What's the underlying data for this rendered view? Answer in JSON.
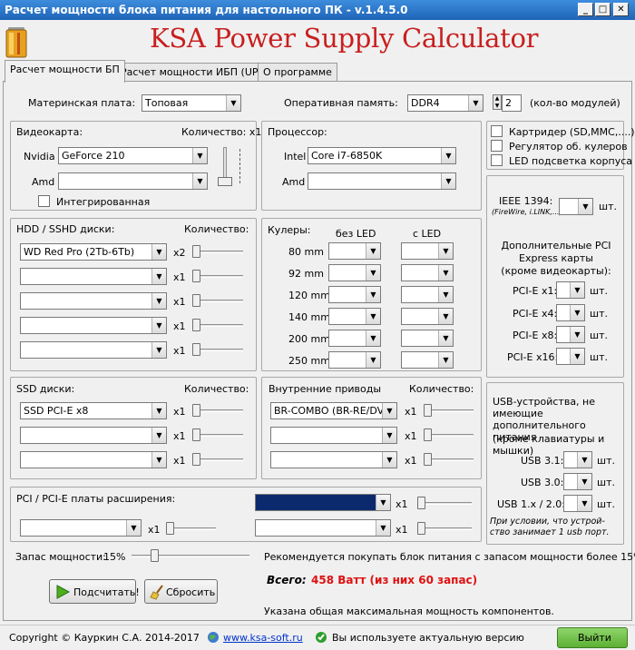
{
  "window": {
    "title": "Расчет мощности блока питания для настольного ПК - v.1.4.5.0",
    "min": "_",
    "max": "□",
    "close": "✕"
  },
  "app": {
    "title": "KSA Power Supply Calculator"
  },
  "tabs": [
    "Расчет мощности БП",
    "Расчет мощности ИБП (UPS)",
    "О программе"
  ],
  "top": {
    "mb_label": "Материнская плата:",
    "mb_value": "Топовая",
    "ram_label": "Оперативная память:",
    "ram_value": "DDR4",
    "ram_modules": "2",
    "ram_modules_note": "(кол-во модулей)"
  },
  "gpu": {
    "title": "Видеокарта:",
    "qty_label": "Количество: x1",
    "nvidia_label": "Nvidia",
    "nvidia_value": "GeForce 210",
    "amd_label": "Amd",
    "amd_value": "",
    "integrated": "Интегрированная"
  },
  "cpu": {
    "title": "Процессор:",
    "intel_label": "Intel",
    "intel_value": "Core i7-6850K",
    "amd_label": "Amd",
    "amd_value": ""
  },
  "extras": {
    "cardreader": "Картридер (SD,MMC,....)",
    "fan_ctrl": "Регулятор об. кулеров",
    "led": "LED подсветка корпуса"
  },
  "ieee": {
    "label": "IEEE 1394:",
    "sub": "(FireWire, i.LINK,...)",
    "unit": "шт."
  },
  "pcie": {
    "title": "Дополнительные PCI Express карты (кроме видеокарты):",
    "rows": [
      {
        "label": "PCI-E x1:",
        "unit": "шт."
      },
      {
        "label": "PCI-E x4:",
        "unit": "шт."
      },
      {
        "label": "PCI-E x8:",
        "unit": "шт."
      },
      {
        "label": "PCI-E x16:",
        "unit": "шт."
      }
    ]
  },
  "usb": {
    "title": "USB-устройства, не имеющие дополнительного питания",
    "sub": "(кроме клавиатуры и мышки)",
    "rows": [
      {
        "label": "USB 3.1:",
        "unit": "шт."
      },
      {
        "label": "USB 3.0:",
        "unit": "шт."
      },
      {
        "label": "USB 1.x / 2.0:",
        "unit": "шт."
      }
    ],
    "note": "При условии, что устрой- ство занимает 1 usb порт."
  },
  "hdd": {
    "title": "HDD / SSHD диски:",
    "qty_label": "Количество:",
    "rows": [
      {
        "value": "WD Red Pro (2Tb-6Tb)",
        "qty": "x2"
      },
      {
        "value": "",
        "qty": "x1"
      },
      {
        "value": "",
        "qty": "x1"
      },
      {
        "value": "",
        "qty": "x1"
      },
      {
        "value": "",
        "qty": "x1"
      }
    ]
  },
  "coolers": {
    "title": "Кулеры:",
    "col1": "без LED",
    "col2": "с LED",
    "rows": [
      "80 mm",
      "92 mm",
      "120 mm",
      "140 mm",
      "200 mm",
      "250 mm"
    ]
  },
  "ssd": {
    "title": "SSD диски:",
    "qty_label": "Количество:",
    "rows": [
      {
        "value": "SSD PCI-E x8",
        "qty": "x1"
      },
      {
        "value": "",
        "qty": "x1"
      },
      {
        "value": "",
        "qty": "x1"
      }
    ]
  },
  "drives": {
    "title": "Внутренние приводы",
    "qty_label": "Количество:",
    "rows": [
      {
        "value": "BR-COMBO (BR-RE/DVD",
        "qty": "x1"
      },
      {
        "value": "",
        "qty": "x1"
      },
      {
        "value": "",
        "qty": "x1"
      }
    ]
  },
  "pci": {
    "title": "PCI / PCI-E платы расширения:",
    "rows": [
      {
        "qty": "x1"
      },
      {
        "qty": "x1"
      },
      {
        "qty": "x1"
      }
    ]
  },
  "reserve": {
    "label": "Запас мощности:",
    "value": "15%",
    "hint": "Рекомендуется покупать блок питания с запасом мощности более 15%."
  },
  "result": {
    "label": "Всего:",
    "value": "458 Ватт (из них 60 запас)",
    "note": "Указана общая максимальная мощность компонентов."
  },
  "buttons": {
    "calc": "Подсчитать!",
    "reset": "Сбросить",
    "exit": "Выйти"
  },
  "status": {
    "copyright": "Copyright © Кауркин С.А. 2014-2017",
    "link": "www.ksa-soft.ru",
    "version": "Вы используете актуальную версию"
  },
  "colors": {
    "title_red": "#c81f1f",
    "result_red": "#e01010",
    "exit_green": "#6cc24a"
  }
}
